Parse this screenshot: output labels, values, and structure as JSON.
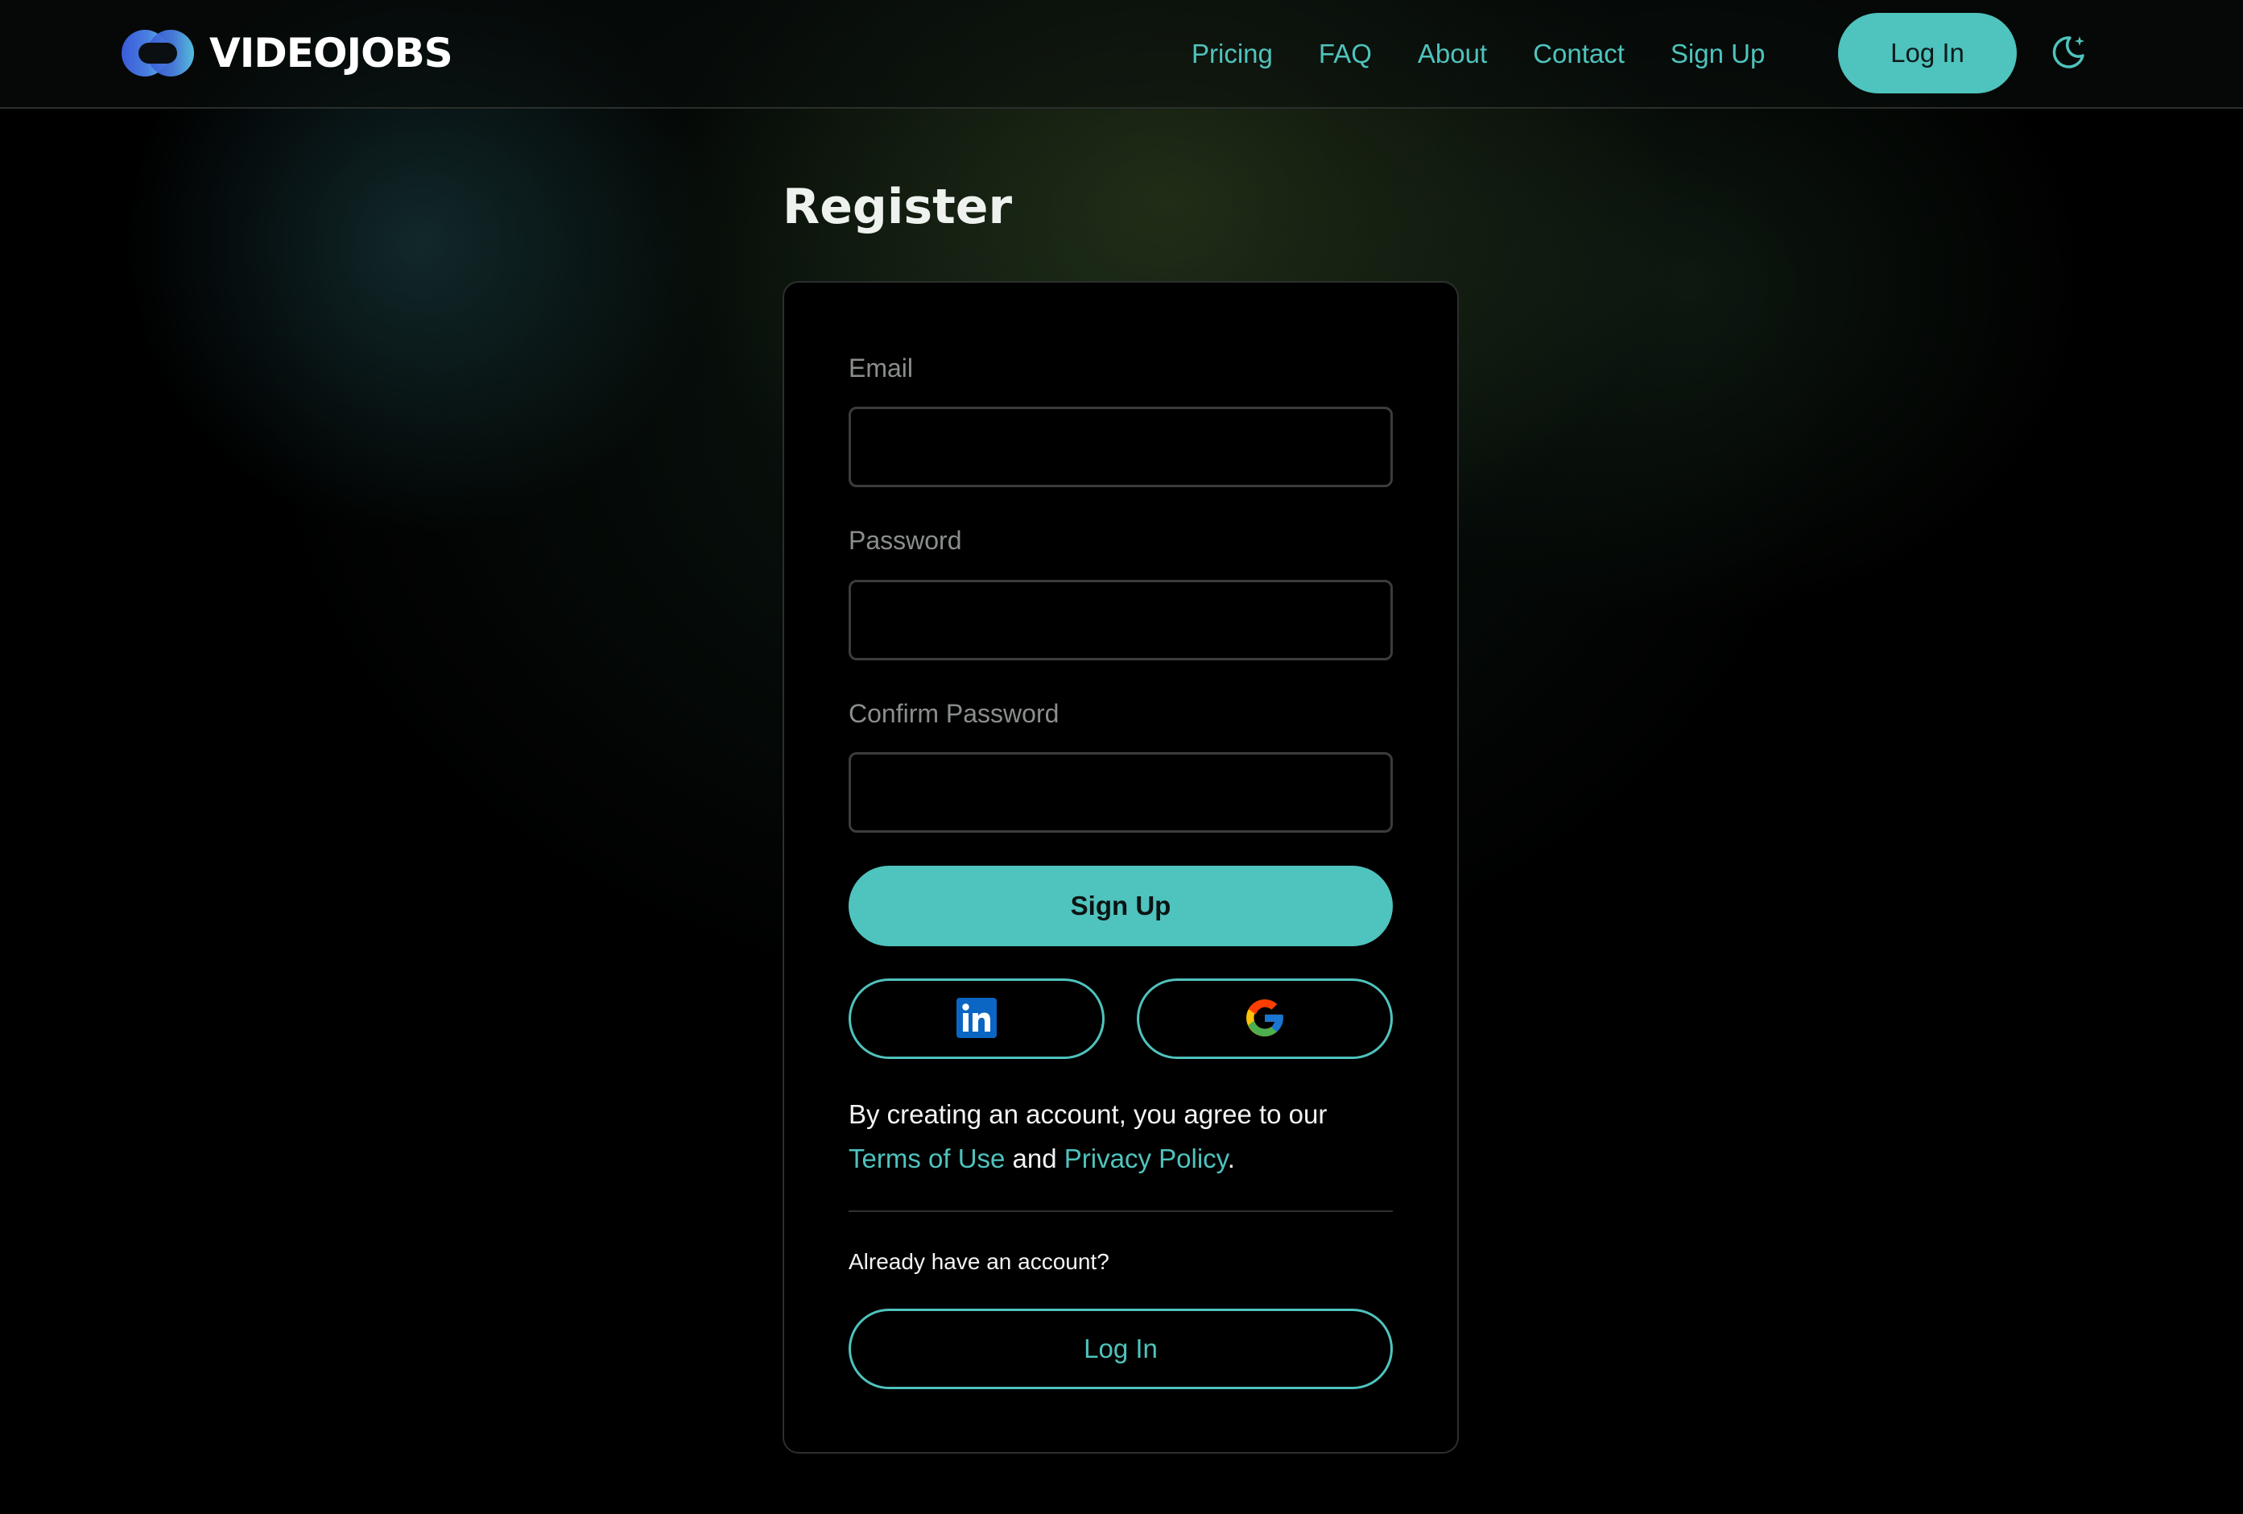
{
  "brand": {
    "name": "VIDEOJOBS",
    "logo_icon": "logo-infinity-icon",
    "accent_color": "#4fc3bd"
  },
  "nav": {
    "links": [
      {
        "label": "Pricing"
      },
      {
        "label": "FAQ"
      },
      {
        "label": "About"
      },
      {
        "label": "Contact"
      },
      {
        "label": "Sign Up"
      }
    ],
    "login_label": "Log In",
    "theme_toggle_icon": "moon-star-icon"
  },
  "page": {
    "title": "Register"
  },
  "form": {
    "email_label": "Email",
    "email_value": "",
    "password_label": "Password",
    "password_value": "",
    "confirm_label": "Confirm Password",
    "confirm_value": "",
    "signup_label": "Sign Up",
    "social": [
      {
        "icon": "linkedin-icon"
      },
      {
        "icon": "google-icon"
      }
    ],
    "legal": {
      "prefix": "By creating an account, you agree to our",
      "terms_link": "Terms of Use",
      "middle": "and",
      "privacy_link": "Privacy Policy",
      "suffix": "."
    },
    "already_text": "Already have an account?",
    "login_label": "Log In"
  }
}
